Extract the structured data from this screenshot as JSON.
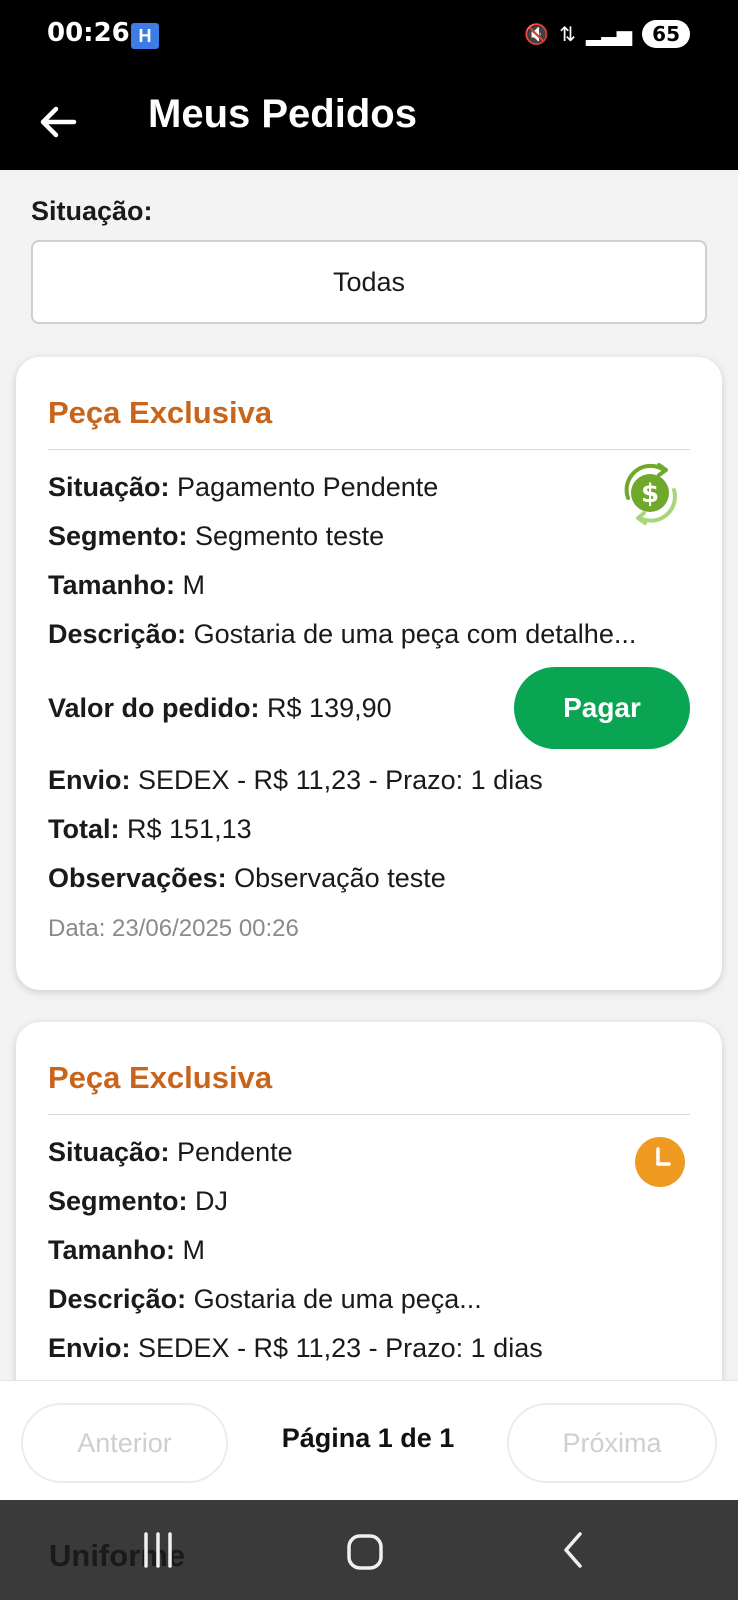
{
  "status_bar": {
    "time": "00:26",
    "app_badge": "H",
    "mute_glyph": "🔇",
    "wifi_glyph": "⇅",
    "signal_glyph": "▂▃▅",
    "battery": "65"
  },
  "app_bar": {
    "title": "Meus Pedidos",
    "back_icon": "arrow-left-icon"
  },
  "filter": {
    "label": "Situação:",
    "value": "Todas"
  },
  "orders": [
    {
      "title": "Peça Exclusiva",
      "status_label": "Situação:",
      "status_value": "Pagamento Pendente",
      "status_icon": "payment-pending-icon",
      "segment_label": "Segmento:",
      "segment_value": "Segmento teste",
      "size_label": "Tamanho:",
      "size_value": "M",
      "description_label": "Descrição:",
      "description_value": "Gostaria de uma peça com detalhe...",
      "order_value_label": "Valor do pedido:",
      "order_value": "R$ 139,90",
      "pay_button": "Pagar",
      "shipping_label": "Envio:",
      "shipping_value": "SEDEX - R$ 11,23 - Prazo: 1 dias",
      "total_label": "Total:",
      "total_value": "R$ 151,13",
      "notes_label": "Observações:",
      "notes_value": "Observação teste",
      "date": "Data: 23/06/2025 00:26"
    },
    {
      "title": "Peça Exclusiva",
      "status_label": "Situação:",
      "status_value": "Pendente",
      "status_icon": "clock-icon",
      "segment_label": "Segmento:",
      "segment_value": "DJ",
      "size_label": "Tamanho:",
      "size_value": "M",
      "description_label": "Descrição:",
      "description_value": "Gostaria de uma peça...",
      "shipping_label": "Envio:",
      "shipping_value": "SEDEX - R$ 11,23 - Prazo: 1 dias"
    }
  ],
  "pagination": {
    "previous": "Anterior",
    "page_label": "Página 1 de 1",
    "next": "Próxima"
  },
  "peek_card_title": "Uniforme",
  "colors": {
    "accent_title": "#c8651b",
    "pay_button": "#0aa553",
    "clock_icon": "#ef9a21",
    "payment_icon": "#6fa82a"
  }
}
